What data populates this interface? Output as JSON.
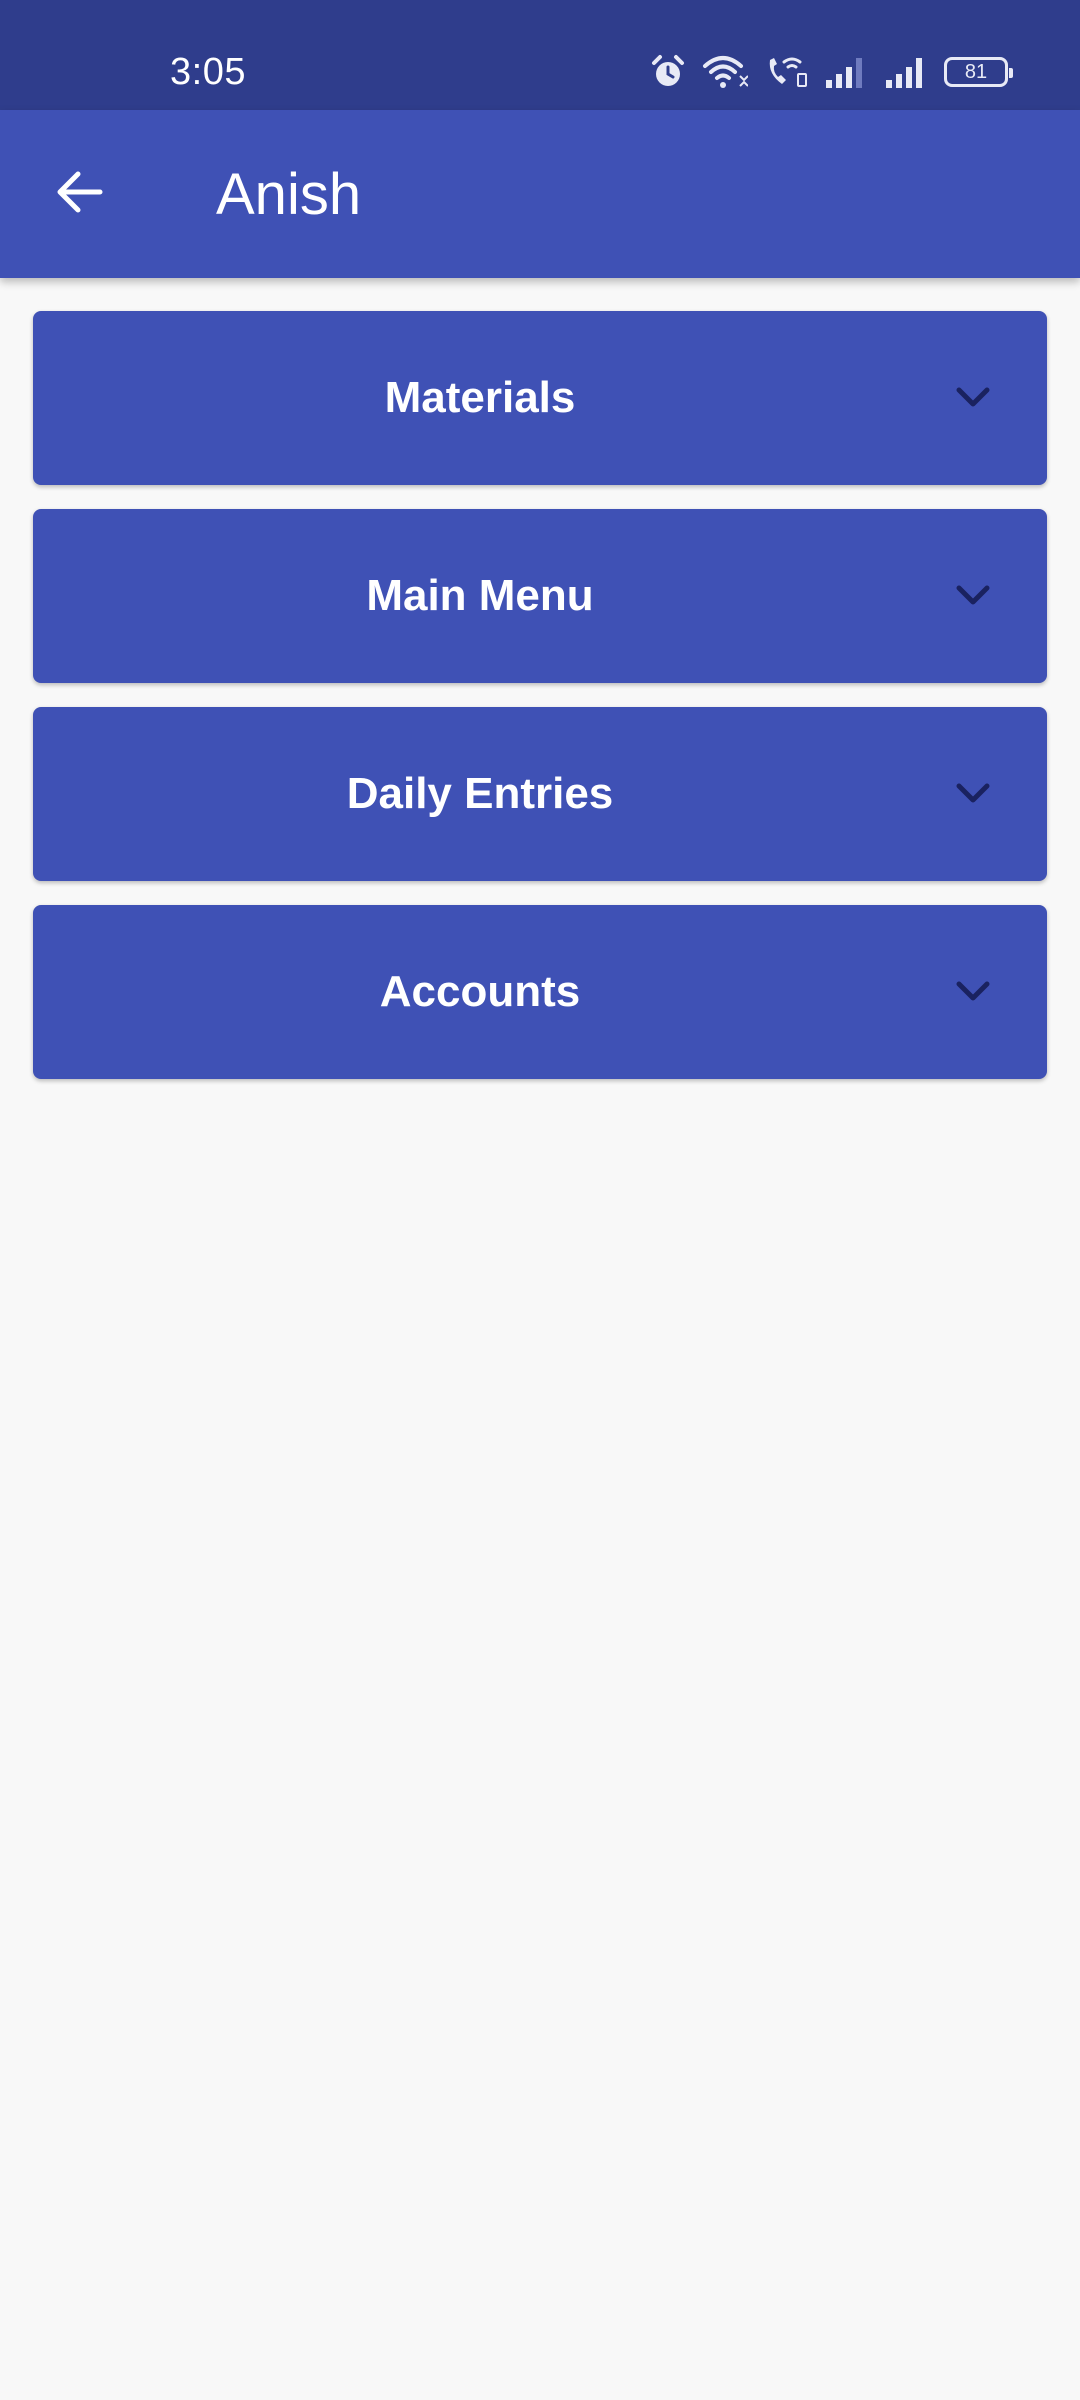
{
  "status_bar": {
    "time": "3:05",
    "battery_level": "81",
    "icons": [
      "alarm-icon",
      "wifi-icon",
      "wifi-calling-icon",
      "signal-icon-1",
      "signal-icon-2",
      "battery-icon"
    ]
  },
  "app_bar": {
    "title": "Anish",
    "back_icon": "arrow-back-icon"
  },
  "sections": [
    {
      "label": "Materials",
      "icon": "chevron-down-icon"
    },
    {
      "label": "Main Menu",
      "icon": "chevron-down-icon"
    },
    {
      "label": "Daily Entries",
      "icon": "chevron-down-icon"
    },
    {
      "label": "Accounts",
      "icon": "chevron-down-icon"
    }
  ],
  "colors": {
    "status_bar": "#2f3d8c",
    "primary": "#3f51b5",
    "background": "#f8f8f8",
    "chevron": "#1a2260",
    "text": "#ffffff"
  }
}
